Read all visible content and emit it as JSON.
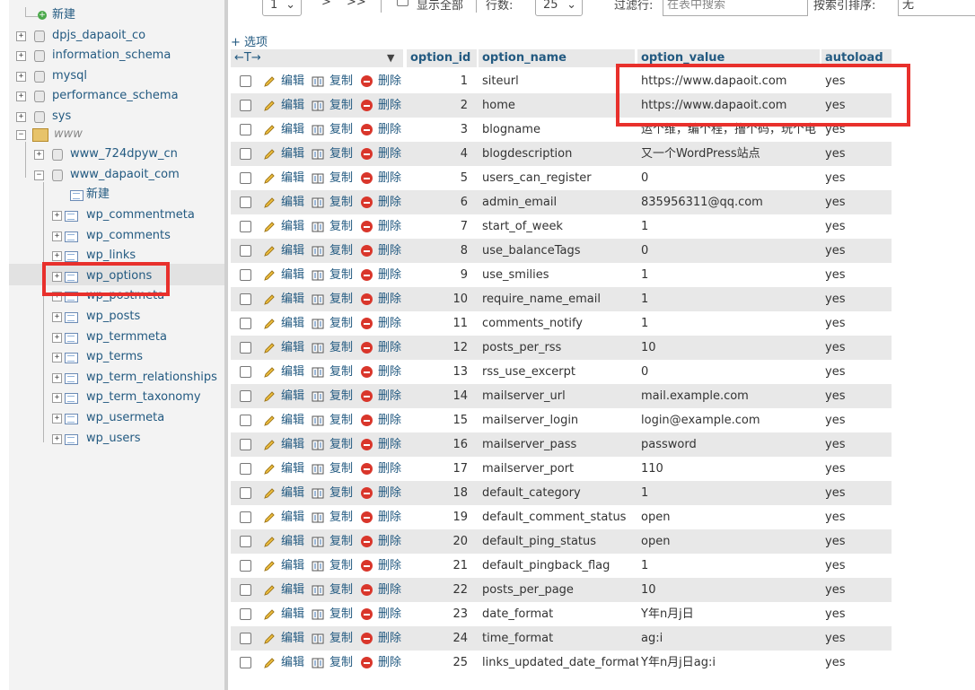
{
  "nav": {
    "new_label": "新建",
    "databases": [
      "dpjs_dapaoit_co",
      "information_schema",
      "mysql",
      "performance_schema",
      "sys"
    ],
    "group": "www",
    "subdb1": "www_724dpyw_cn",
    "subdb2": "www_dapaoit_com",
    "sub_new_label": "新建",
    "tables": [
      "wp_commentmeta",
      "wp_comments",
      "wp_links",
      "wp_options",
      "wp_postmeta",
      "wp_posts",
      "wp_termmeta",
      "wp_terms",
      "wp_term_relationships",
      "wp_term_taxonomy",
      "wp_usermeta",
      "wp_users"
    ],
    "selected_table": "wp_options"
  },
  "toolbar": {
    "page_select": "1",
    "next": ">",
    "last": ">>",
    "show_all_label": "显示全部",
    "rows_label": "行数:",
    "rows_value": "25",
    "filter_label": "过滤行:",
    "filter_placeholder": "在表中搜索",
    "sort_label": "按索引排序:",
    "sort_value": "无"
  },
  "table": {
    "options_link": "+ 选项",
    "col_arrows": "←T→",
    "columns": [
      "option_id",
      "option_name",
      "option_value",
      "autoload"
    ],
    "action_edit": "编辑",
    "action_copy": "复制",
    "action_delete": "删除",
    "rows": [
      {
        "id": "1",
        "name": "siteurl",
        "value": "https://www.dapaoit.com",
        "autoload": "yes"
      },
      {
        "id": "2",
        "name": "home",
        "value": "https://www.dapaoit.com",
        "autoload": "yes"
      },
      {
        "id": "3",
        "name": "blogname",
        "value": "运个维，编个程，撸个码，玩个电",
        "autoload": "yes"
      },
      {
        "id": "4",
        "name": "blogdescription",
        "value": "又一个WordPress站点",
        "autoload": "yes"
      },
      {
        "id": "5",
        "name": "users_can_register",
        "value": "0",
        "autoload": "yes"
      },
      {
        "id": "6",
        "name": "admin_email",
        "value": "835956311@qq.com",
        "autoload": "yes"
      },
      {
        "id": "7",
        "name": "start_of_week",
        "value": "1",
        "autoload": "yes"
      },
      {
        "id": "8",
        "name": "use_balanceTags",
        "value": "0",
        "autoload": "yes"
      },
      {
        "id": "9",
        "name": "use_smilies",
        "value": "1",
        "autoload": "yes"
      },
      {
        "id": "10",
        "name": "require_name_email",
        "value": "1",
        "autoload": "yes"
      },
      {
        "id": "11",
        "name": "comments_notify",
        "value": "1",
        "autoload": "yes"
      },
      {
        "id": "12",
        "name": "posts_per_rss",
        "value": "10",
        "autoload": "yes"
      },
      {
        "id": "13",
        "name": "rss_use_excerpt",
        "value": "0",
        "autoload": "yes"
      },
      {
        "id": "14",
        "name": "mailserver_url",
        "value": "mail.example.com",
        "autoload": "yes"
      },
      {
        "id": "15",
        "name": "mailserver_login",
        "value": "login@example.com",
        "autoload": "yes"
      },
      {
        "id": "16",
        "name": "mailserver_pass",
        "value": "password",
        "autoload": "yes"
      },
      {
        "id": "17",
        "name": "mailserver_port",
        "value": "110",
        "autoload": "yes"
      },
      {
        "id": "18",
        "name": "default_category",
        "value": "1",
        "autoload": "yes"
      },
      {
        "id": "19",
        "name": "default_comment_status",
        "value": "open",
        "autoload": "yes"
      },
      {
        "id": "20",
        "name": "default_ping_status",
        "value": "open",
        "autoload": "yes"
      },
      {
        "id": "21",
        "name": "default_pingback_flag",
        "value": "1",
        "autoload": "yes"
      },
      {
        "id": "22",
        "name": "posts_per_page",
        "value": "10",
        "autoload": "yes"
      },
      {
        "id": "23",
        "name": "date_format",
        "value": "Y年n月j日",
        "autoload": "yes"
      },
      {
        "id": "24",
        "name": "time_format",
        "value": "ag:i",
        "autoload": "yes"
      },
      {
        "id": "25",
        "name": "links_updated_date_format",
        "value": "Y年n月j日ag:i",
        "autoload": "yes"
      }
    ]
  },
  "colors": {
    "link": "#235a81",
    "highlight_box": "#e8302c",
    "delete_icon": "#d9362b"
  }
}
